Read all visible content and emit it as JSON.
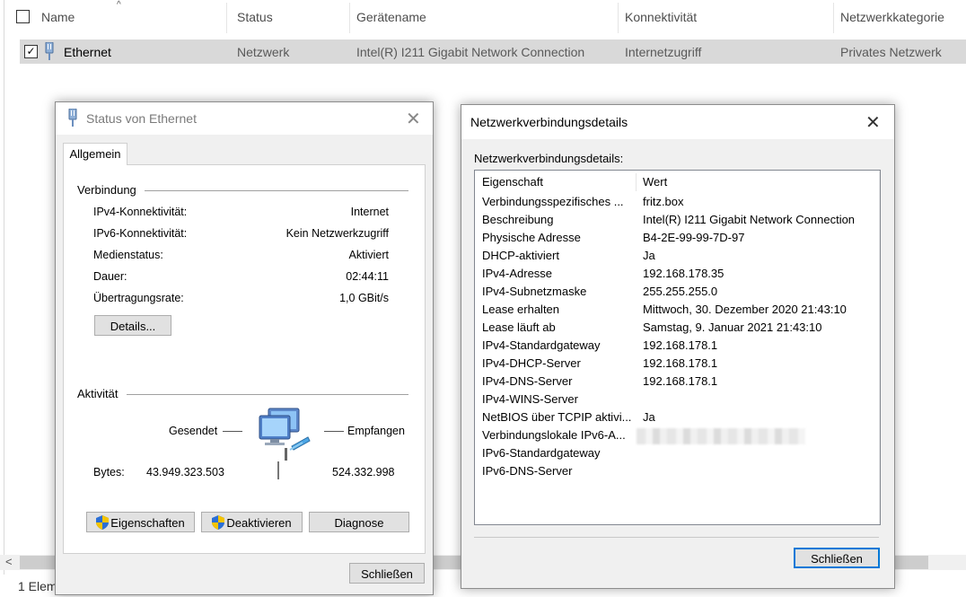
{
  "explorer": {
    "columns": [
      "Name",
      "Status",
      "Gerätename",
      "Konnektivität",
      "Netzwerkkategorie"
    ],
    "row": {
      "name": "Ethernet",
      "status": "Netzwerk",
      "device": "Intel(R) I211 Gigabit Network Connection",
      "connectivity": "Internetzugriff",
      "category": "Privates Netzwerk",
      "checked": "✓"
    },
    "status_bar": "1 Elem",
    "scroll_left": "<"
  },
  "status_window": {
    "title": "Status von Ethernet",
    "close": "✕",
    "tab": "Allgemein",
    "connection_group": "Verbindung",
    "fields": [
      {
        "key": "IPv4-Konnektivität:",
        "value": "Internet"
      },
      {
        "key": "IPv6-Konnektivität:",
        "value": "Kein Netzwerkzugriff"
      },
      {
        "key": "Medienstatus:",
        "value": "Aktiviert"
      },
      {
        "key": "Dauer:",
        "value": "02:44:11"
      },
      {
        "key": "Übertragungsrate:",
        "value": "1,0 GBit/s"
      }
    ],
    "details_button": "Details...",
    "activity_group": "Aktivität",
    "sent_label": "Gesendet",
    "received_label": "Empfangen",
    "bytes_label": "Bytes:",
    "bytes_sent": "43.949.323.503",
    "bytes_received": "524.332.998",
    "properties_button": "Eigenschaften",
    "disable_button": "Deaktivieren",
    "diagnose_button": "Diagnose",
    "close_button": "Schließen"
  },
  "details_window": {
    "title": "Netzwerkverbindungsdetails",
    "close": "✕",
    "caption": "Netzwerkverbindungsdetails:",
    "header": {
      "property": "Eigenschaft",
      "value": "Wert"
    },
    "rows": [
      {
        "property": "Verbindungsspezifisches ...",
        "value": "fritz.box"
      },
      {
        "property": "Beschreibung",
        "value": "Intel(R) I211 Gigabit Network Connection"
      },
      {
        "property": "Physische Adresse",
        "value": "B4-2E-99-99-7D-97"
      },
      {
        "property": "DHCP-aktiviert",
        "value": "Ja"
      },
      {
        "property": "IPv4-Adresse",
        "value": "192.168.178.35"
      },
      {
        "property": "IPv4-Subnetzmaske",
        "value": "255.255.255.0"
      },
      {
        "property": "Lease erhalten",
        "value": "Mittwoch, 30. Dezember 2020 21:43:10"
      },
      {
        "property": "Lease läuft ab",
        "value": "Samstag, 9. Januar 2021 21:43:10"
      },
      {
        "property": "IPv4-Standardgateway",
        "value": "192.168.178.1"
      },
      {
        "property": "IPv4-DHCP-Server",
        "value": "192.168.178.1"
      },
      {
        "property": "IPv4-DNS-Server",
        "value": "192.168.178.1"
      },
      {
        "property": "IPv4-WINS-Server",
        "value": ""
      },
      {
        "property": "NetBIOS über TCPIP aktivi...",
        "value": "Ja"
      },
      {
        "property": "Verbindungslokale IPv6-A...",
        "value": ""
      },
      {
        "property": "IPv6-Standardgateway",
        "value": ""
      },
      {
        "property": "IPv6-DNS-Server",
        "value": ""
      }
    ],
    "close_button": "Schließen"
  },
  "colors": {
    "selected_row": "#d9d9d9",
    "dialog_bg": "#f0f0f0",
    "button_bg": "#e1e1e1",
    "focus_border": "#0078d7"
  },
  "icons": [
    "ethernet-adapter-icon",
    "network-activity-icon",
    "uac-shield-icon",
    "close-icon",
    "checkbox-icon",
    "sort-arrow-icon"
  ]
}
